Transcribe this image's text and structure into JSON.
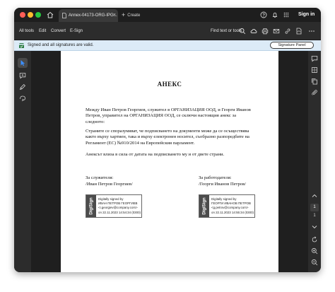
{
  "titlebar": {
    "tab_title": "Annex-04173-ORG-IPG...",
    "tab_close": "×",
    "new_tab_label": "Create",
    "sign_in": "Sign in"
  },
  "menubar": {
    "items": [
      "All tools",
      "Edit",
      "Convert",
      "E-Sign"
    ],
    "find_label": "Find text or tools"
  },
  "signature_bar": {
    "message": "Signed and all signatures are valid.",
    "button": "Signature Panel"
  },
  "document": {
    "title": "АНЕКС",
    "paragraphs": [
      "Между Иван Петров Георгиев, служител в ОРГАНИЗАЦИЯ ООД, и Георги Иванов Петров, управител на ОРГАНИЗАЦИЯ ООД, се сключи настоящия анекс за следното:",
      "Страните се споразумяват, че подписването на документи може да се осъществява както върху хартиен, така и върху електронен носител, съобразно разпоредбите на Регламент (ЕС) №910/2014 на Европейския парламент.",
      "Анексът влиза в сила от датата на подписването му и от двете страни."
    ],
    "employee": {
      "label": "За служителя:",
      "name": "/Иван Петров Георгиев/",
      "stamp_text": "DigiSign",
      "sig_lines": [
        "Digitally signed by",
        "ИВАН ПЕТРОВ ГЕОРГИЕВ",
        "<i.georgiev@company.com>",
        "on 22.11.2023 14:54:34 (0300)"
      ]
    },
    "employer": {
      "label": "За работодателя:",
      "name": "/Георги Иванов Петров/",
      "stamp_text": "DigiSign",
      "sig_lines": [
        "Digitally signed by",
        "ГЕОРГИ ИВАНОВ ПЕТРОВ",
        "<g.petrov@company.com>",
        "on 22.11.2023 14:55:34 (0300)"
      ]
    }
  },
  "right_rail": {
    "current_page": "1",
    "total_pages": "1"
  },
  "colors": {
    "window_bg": "#2c2c2c",
    "titlebar_bg": "#1e1e1e",
    "signature_bar_bg": "#dcebf7",
    "signature_ok": "#2d7d46",
    "selection_blue": "#3b8fff"
  },
  "icons": {
    "titlebar": [
      "home-icon",
      "document-icon",
      "help-icon",
      "bell-icon",
      "apps-grid-icon"
    ],
    "toolbar": [
      "search-icon",
      "cloud-icon",
      "print-icon",
      "mail-icon",
      "link-icon",
      "pdf-icon"
    ],
    "left_rail": [
      "select-pointer-icon",
      "comment-add-icon",
      "highlight-pen-icon",
      "draw-shape-icon"
    ],
    "right_rail": [
      "comments-icon",
      "pages-icon",
      "copy-icon",
      "attachments-icon",
      "page-up-icon",
      "page-down-icon",
      "rotate-icon",
      "zoom-in-icon",
      "zoom-out-icon",
      "more-icon"
    ]
  }
}
